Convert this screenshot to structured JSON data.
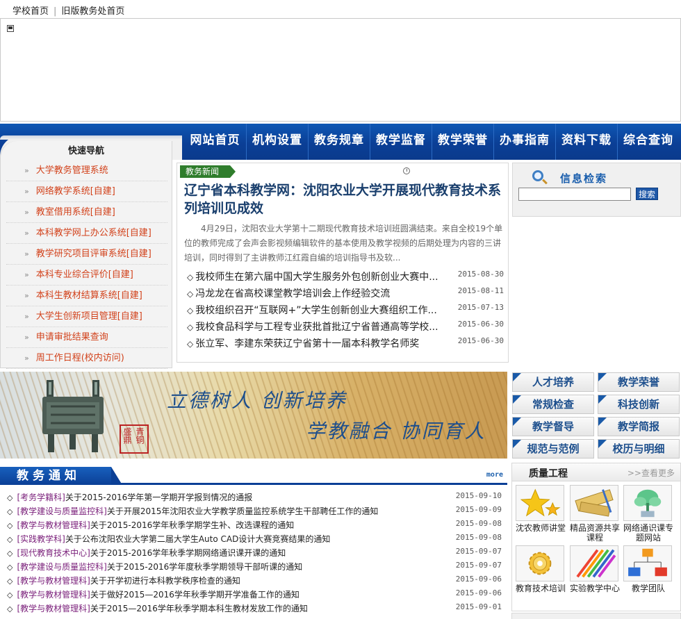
{
  "top_links": {
    "home": "学校首页",
    "separator": "|",
    "old_site": "旧版教务处首页"
  },
  "nav": {
    "items": [
      "网站首页",
      "机构设置",
      "教务规章",
      "教学监督",
      "教学荣誉",
      "办事指南",
      "资料下载",
      "综合查询"
    ]
  },
  "quick_nav": {
    "title": "快速导航",
    "arrow": "»",
    "items": [
      "大学教务管理系统",
      "网络教学系统[自建]",
      "教室借用系统[自建]",
      "本科教学网上办公系统[自建]",
      "教学研究项目评审系统[自建]",
      "本科专业综合评价[自建]",
      "本科生教材结算系统[自建]",
      "大学生创新项目管理[自建]",
      "申请审批结果查询",
      "周工作日程(校内访问)"
    ]
  },
  "news": {
    "tag": "教务新闻",
    "headline": "辽宁省本科教学网：沈阳农业大学开展现代教育技术系列培训见成效",
    "summary": "4月29日，沈阳农业大学第十二期现代教育技术培训班圆满结束。来自全校19个单位的教师完成了会声会影视频编辑软件的基本使用及教学视频的后期处理为内容的三讲培训，同时得到了主讲教师江红霞自编的培训指导书及软...",
    "bullet": "◇",
    "items": [
      {
        "title": "我校师生在第六届中国大学生服务外包创新创业大赛中...",
        "date": "2015-08-30"
      },
      {
        "title": "冯龙龙在省高校课堂教学培训会上作经验交流",
        "date": "2015-08-11"
      },
      {
        "title": "我校组织召开“互联网+”大学生创新创业大赛组织工作...",
        "date": "2015-07-13"
      },
      {
        "title": "我校食品科学与工程专业获批首批辽宁省普通高等学校...",
        "date": "2015-06-30"
      },
      {
        "title": "张立军、李建东荣获辽宁省第十一届本科教学名师奖",
        "date": "2015-06-30"
      }
    ]
  },
  "search": {
    "title": "信息检索",
    "value": "",
    "button": "搜索"
  },
  "slogan": {
    "line1": "立德树人  创新培养",
    "line2": "学教融合  协同育人",
    "seal": "青铜盛鼎"
  },
  "categories": [
    "人才培养",
    "教学荣誉",
    "常规检查",
    "科技创新",
    "教学督导",
    "教学简报",
    "规范与范例",
    "校历与明细"
  ],
  "notices": {
    "title": "教务通知",
    "more": "more",
    "bullet": "◇",
    "items": [
      {
        "cat": "[考务学籍科]",
        "title": "关于2015-2016学年第一学期开学报到情况的通报",
        "date": "2015-09-10"
      },
      {
        "cat": "[教学建设与质量监控科]",
        "title": "关于开展2015年沈阳农业大学教学质量监控系统学生干部聘任工作的通知",
        "date": "2015-09-09"
      },
      {
        "cat": "[教学与教材管理科]",
        "title": "关于2015-2016学年秋季学期学生补、改选课程的通知",
        "date": "2015-09-08"
      },
      {
        "cat": "[实践教学科]",
        "title": "关于公布沈阳农业大学第二届大学生Auto CAD设计大赛竞赛结果的通知",
        "date": "2015-09-08"
      },
      {
        "cat": "[现代教育技术中心]",
        "title": "关于2015-2016学年秋季学期网络通识课开课的通知",
        "date": "2015-09-07"
      },
      {
        "cat": "[教学建设与质量监控科]",
        "title": "关于2015-2016学年度秋季学期领导干部听课的通知",
        "date": "2015-09-07"
      },
      {
        "cat": "[教学与教材管理科]",
        "title": "关于开学初进行本科教学秩序检查的通知",
        "date": "2015-09-06"
      },
      {
        "cat": "[教学与教材管理科]",
        "title": "关于做好2015—2016学年秋季学期开学准备工作的通知",
        "date": "2015-09-06"
      },
      {
        "cat": "[教学与教材管理科]",
        "title": "关于2015—2016学年秋季学期本科生教材发放工作的通知",
        "date": "2015-09-01"
      }
    ]
  },
  "quality": {
    "title": "质量工程",
    "more": ">>查看更多",
    "tiles": [
      {
        "label": "沈农教师讲堂",
        "icon": "star-icon"
      },
      {
        "label": "精品资源共享课程",
        "icon": "ruler-icon"
      },
      {
        "label": "网络通识课专题网站",
        "icon": "plant-icon"
      },
      {
        "label": "教育技术培训",
        "icon": "gear-icon"
      },
      {
        "label": "实验教学中心",
        "icon": "pencils-icon"
      },
      {
        "label": "教学团队",
        "icon": "org-chart-icon"
      }
    ]
  }
}
